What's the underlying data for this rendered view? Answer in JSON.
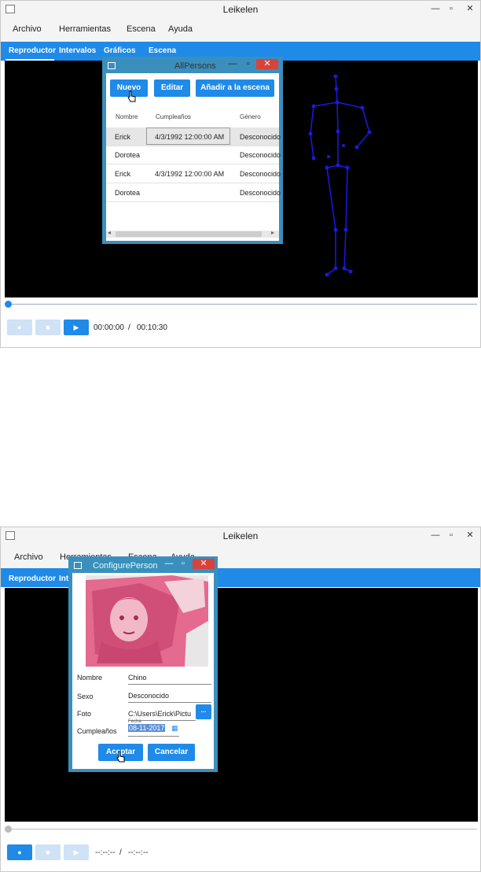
{
  "screens": [
    {
      "window_title": "Leikelen",
      "menu": [
        "Archivo",
        "Herramientas",
        "Escena",
        "Ayuda"
      ],
      "tabs": [
        "Reproductor",
        "Intervalos",
        "Gráficos",
        "Escena"
      ],
      "time_current": "00:00:00",
      "time_separator": "/",
      "time_total": "00:10:30",
      "dialog": {
        "title": "AllPersons",
        "buttons": [
          "Nuevo",
          "Editar",
          "Añadir a la escena"
        ],
        "columns": [
          "Nombre",
          "Cumpleaños",
          "Género"
        ],
        "rows": [
          {
            "nombre": "Erick",
            "cumple": "4/3/1992 12:00:00 AM",
            "genero": "Desconocido"
          },
          {
            "nombre": "Dorotea",
            "cumple": "",
            "genero": "Desconocido"
          },
          {
            "nombre": "Erick",
            "cumple": "4/3/1992 12:00:00 AM",
            "genero": "Desconocido"
          },
          {
            "nombre": "Dorotea",
            "cumple": "",
            "genero": "Desconocido"
          }
        ]
      }
    },
    {
      "window_title": "Leikelen",
      "menu": [
        "Archivo",
        "Herramientas",
        "Escena",
        "Ayuda"
      ],
      "tabs": [
        "Reproductor",
        "Int"
      ],
      "time_current": "--:--:--",
      "time_separator": "/",
      "time_total": "--:--:--",
      "dialog": {
        "title": "ConfigurePerson",
        "fields": {
          "nombre_label": "Nombre",
          "nombre_value": "Chino",
          "sexo_label": "Sexo",
          "sexo_value": "Desconocido",
          "foto_label": "Foto",
          "foto_value": "C:\\Users\\Erick\\Pictu",
          "foto_browse": "...",
          "cumple_label": "Cumpleaños",
          "cumple_caption": "Fecha",
          "cumple_value": "08-11-2017"
        },
        "buttons": [
          "Aceptar",
          "Cancelar"
        ]
      }
    }
  ]
}
